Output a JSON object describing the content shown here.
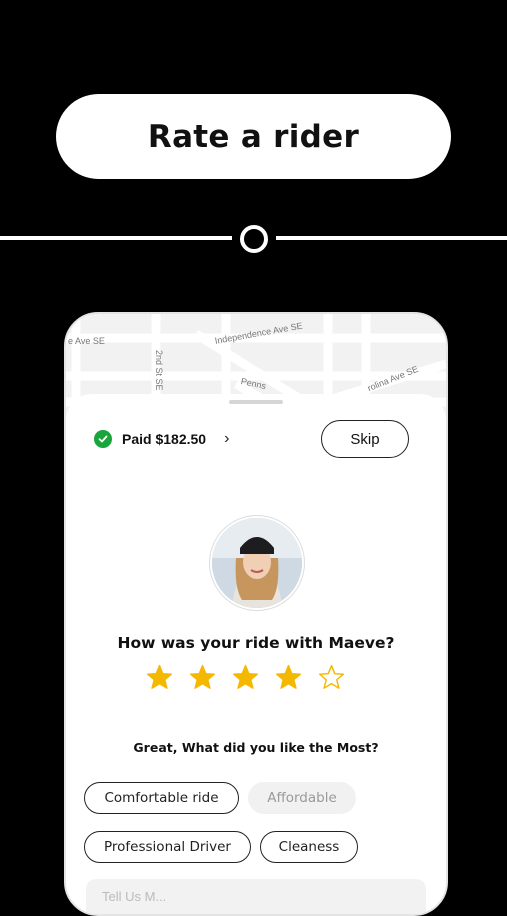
{
  "header": {
    "title": "Rate a rider"
  },
  "map": {
    "streets": [
      "e Ave SE",
      "Independence Ave SE",
      "2nd St SE",
      "Penns",
      "rolina Ave SE"
    ]
  },
  "payment": {
    "status_icon": "check-circle-icon",
    "label": "Paid $182.50",
    "chevron": "›"
  },
  "skip_label": "Skip",
  "rider": {
    "question": "How was your ride with Maeve?"
  },
  "rating": {
    "value": 4,
    "max": 5,
    "filled_color": "#F5B800",
    "empty_color": "#F5B800"
  },
  "feedback": {
    "question": "Great, What did you like the Most?",
    "options": [
      {
        "label": "Comfortable ride",
        "selected": true
      },
      {
        "label": "Affordable",
        "selected": false
      },
      {
        "label": "Professional Driver",
        "selected": true
      },
      {
        "label": "Cleaness",
        "selected": true
      }
    ],
    "input_placeholder": "Tell Us M..."
  }
}
